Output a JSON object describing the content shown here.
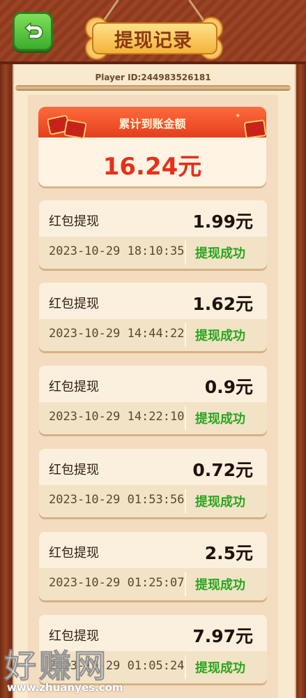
{
  "header": {
    "title": "提现记录",
    "player_id": "Player ID:244983526181"
  },
  "summary": {
    "label": "累计到账金额",
    "total": "16.24元"
  },
  "records": [
    {
      "title": "红包提现",
      "amount": "1.99元",
      "time": "2023-10-29 18:10:35",
      "status": "提现成功"
    },
    {
      "title": "红包提现",
      "amount": "1.62元",
      "time": "2023-10-29 14:44:22",
      "status": "提现成功"
    },
    {
      "title": "红包提现",
      "amount": "0.9元",
      "time": "2023-10-29 14:22:10",
      "status": "提现成功"
    },
    {
      "title": "红包提现",
      "amount": "0.72元",
      "time": "2023-10-29 01:53:56",
      "status": "提现成功"
    },
    {
      "title": "红包提现",
      "amount": "2.5元",
      "time": "2023-10-29 01:25:07",
      "status": "提现成功"
    },
    {
      "title": "红包提现",
      "amount": "7.97元",
      "time": "2023-10-29 01:05:24",
      "status": "提现成功"
    }
  ],
  "watermark": {
    "text": "好赚网",
    "url": "www.zhuanyes.com"
  },
  "icons": {
    "back": "back-arrow-icon"
  },
  "colors": {
    "accent_red": "#e5301b",
    "success_green": "#29a51f",
    "back_button_green": "#3cae2c"
  }
}
